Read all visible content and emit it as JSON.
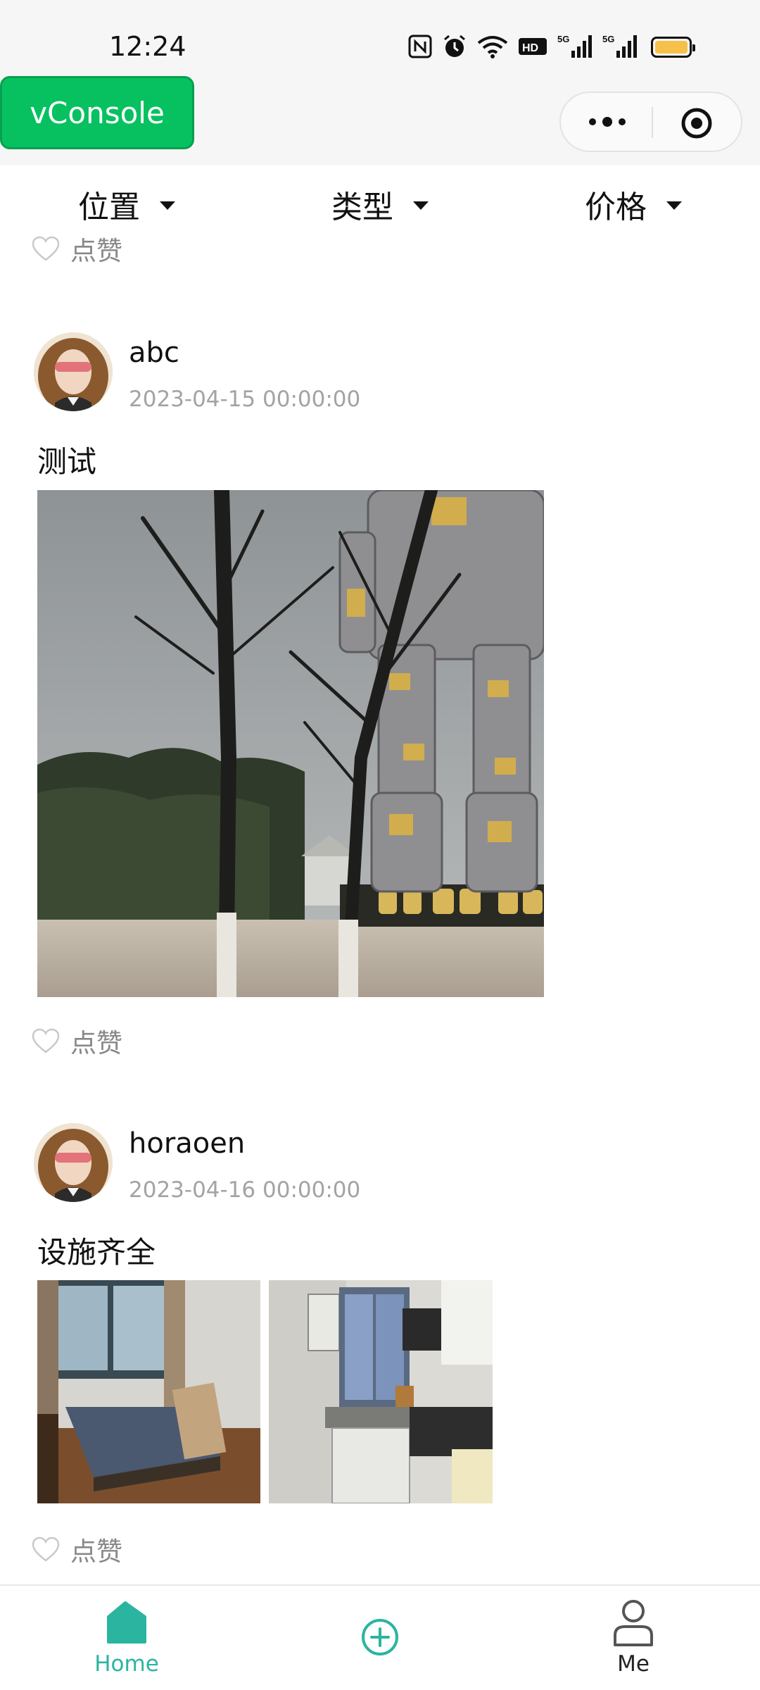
{
  "status_bar": {
    "time": "12:24",
    "icons": [
      "nfc-icon",
      "alarm-icon",
      "wifi-icon",
      "hd-icon",
      "signal-5g-icon",
      "signal-5g-icon",
      "battery-icon"
    ],
    "battery_color": "#f6c14a"
  },
  "vconsole": {
    "label": "vConsole",
    "color": "#07c160"
  },
  "capsule": {
    "icons": [
      "more-icon",
      "close-miniprogram-icon"
    ]
  },
  "filters": [
    {
      "label": "位置"
    },
    {
      "label": "类型"
    },
    {
      "label": "价格"
    }
  ],
  "partial_like": {
    "label": "点赞"
  },
  "posts": [
    {
      "username": "abc",
      "date": "2023-04-15 00:00:00",
      "text": "测试",
      "like_label": "点赞",
      "images": [
        "robot-statue-photo"
      ]
    },
    {
      "username": "horaoen",
      "date": "2023-04-16 00:00:00",
      "text": "设施齐全",
      "like_label": "点赞",
      "images": [
        "bedroom-photo",
        "kitchen-photo"
      ]
    }
  ],
  "tabbar": {
    "active_color": "#2bb5a0",
    "items": [
      {
        "label": "Home",
        "icon": "home-icon",
        "active": true
      },
      {
        "label": "",
        "icon": "add-circle-icon",
        "active": false
      },
      {
        "label": "Me",
        "icon": "user-icon",
        "active": false
      }
    ]
  }
}
